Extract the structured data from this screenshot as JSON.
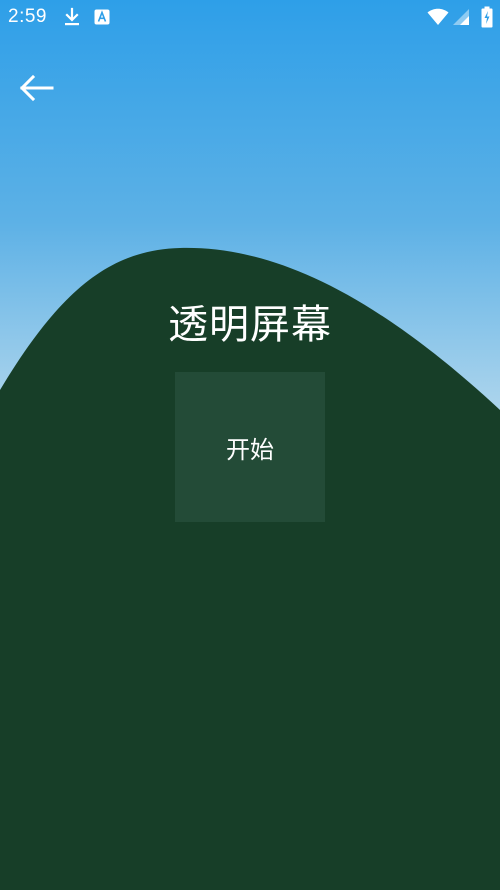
{
  "status_bar": {
    "time": "2:59",
    "icons": [
      "download-icon",
      "app-a-icon",
      "wifi-icon",
      "signal-icon",
      "battery-charging-icon"
    ]
  },
  "toolbar": {
    "back_icon": "arrow-left-icon"
  },
  "main": {
    "title": "透明屏幕",
    "start_label": "开始"
  },
  "colors": {
    "sky_top": "#2e9fe8",
    "sky_bottom": "#cfe6f1",
    "hill": "#173e28",
    "button": "#234b37",
    "text": "#ffffff"
  }
}
